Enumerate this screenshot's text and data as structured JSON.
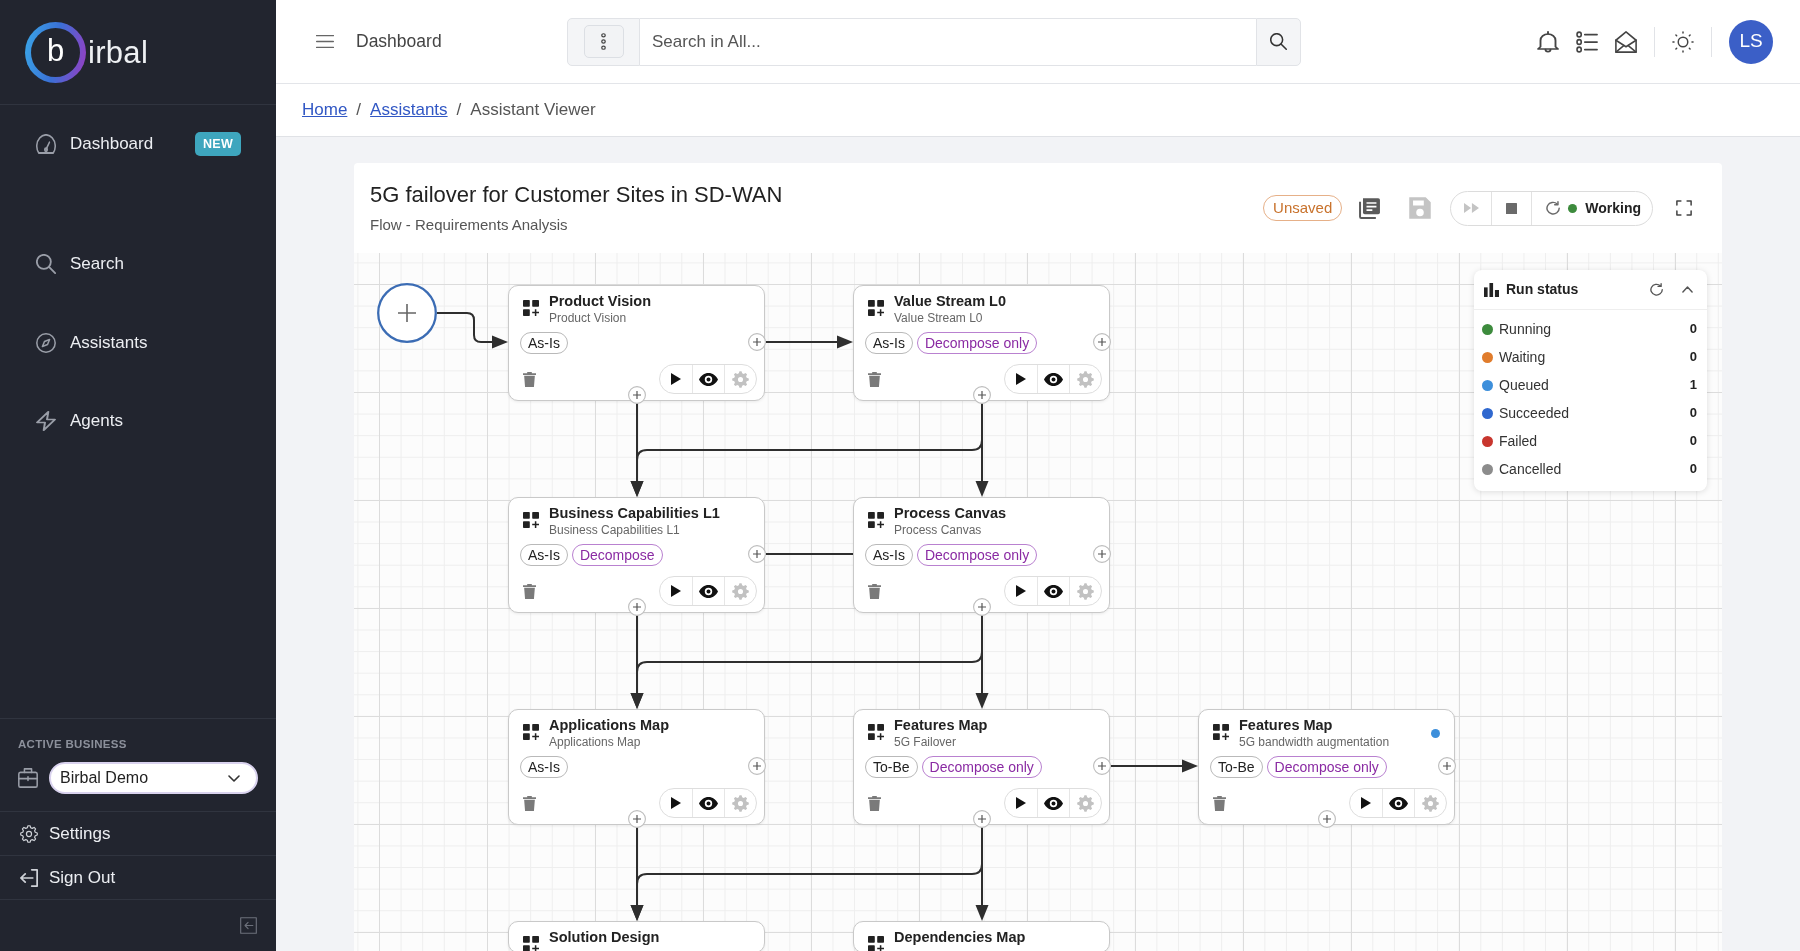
{
  "sidebar": {
    "logo": {
      "mark": "b",
      "text": "irbal"
    },
    "groups": [
      {
        "items": [
          {
            "label": "Dashboard",
            "kind": "dashboard",
            "badge": "NEW",
            "selected": false
          }
        ]
      },
      {
        "items": [
          {
            "label": "Search",
            "kind": "search",
            "selected": false
          },
          {
            "label": "Assistants",
            "kind": "assistants",
            "selected": false
          },
          {
            "label": "Agents",
            "kind": "agents",
            "selected": false
          }
        ]
      }
    ],
    "business": {
      "heading": "ACTIVE BUSINESS",
      "value": "Birbal Demo"
    },
    "footer": [
      {
        "label": "Settings",
        "kind": "settings"
      },
      {
        "label": "Sign Out",
        "kind": "sign-out"
      }
    ]
  },
  "header": {
    "title": "Dashboard",
    "search": {
      "placeholder": "Search in All..."
    },
    "avatar": "LS"
  },
  "breadcrumb": [
    {
      "label": "Home",
      "kind": "link"
    },
    {
      "label": "/",
      "kind": "separator"
    },
    {
      "label": "Assistants",
      "kind": "link"
    },
    {
      "label": "/",
      "kind": "separator"
    },
    {
      "label": "Assistant Viewer",
      "kind": "current"
    }
  ],
  "flow": {
    "title": "5G failover for Customer Sites in SD-WAN",
    "subtitle": "Flow - Requirements Analysis",
    "badge": "Unsaved",
    "tools": [
      {
        "kind": "history",
        "disabled": false
      },
      {
        "kind": "save",
        "disabled": true
      }
    ],
    "run_controls": [
      {
        "kind": "fast-forward",
        "disabled": true
      },
      {
        "kind": "stop",
        "disabled": false
      },
      {
        "kind": "refresh",
        "disabled": false
      }
    ],
    "run_state": "Working"
  },
  "canvas": {
    "start": {
      "links": [
        {
          "kind": "step-right"
        }
      ]
    },
    "rows": [
      {
        "nodes": [
          {
            "title": "Product Vision",
            "subtitle": "Product Vision",
            "tags": [
              {
                "label": "As-Is",
                "kind": "state"
              }
            ],
            "queued": false,
            "links": [
              {
                "kind": "right"
              },
              {
                "kind": "down"
              }
            ]
          },
          {
            "title": "Value Stream L0",
            "subtitle": "Value Stream L0",
            "tags": [
              {
                "label": "As-Is",
                "kind": "state"
              },
              {
                "label": "Decompose only",
                "kind": "mode"
              }
            ],
            "queued": false,
            "links": [
              {
                "kind": "down"
              },
              {
                "kind": "down-left"
              }
            ]
          }
        ]
      },
      {
        "nodes": [
          {
            "title": "Business Capabilities L1",
            "subtitle": "Business Capabilities L1",
            "tags": [
              {
                "label": "As-Is",
                "kind": "state"
              },
              {
                "label": "Decompose",
                "kind": "mode"
              }
            ],
            "queued": false,
            "links": [
              {
                "kind": "right-line"
              },
              {
                "kind": "down"
              }
            ]
          },
          {
            "title": "Process Canvas",
            "subtitle": "Process Canvas",
            "tags": [
              {
                "label": "As-Is",
                "kind": "state"
              },
              {
                "label": "Decompose only",
                "kind": "mode"
              }
            ],
            "queued": false,
            "links": [
              {
                "kind": "down"
              },
              {
                "kind": "down-left"
              }
            ]
          }
        ]
      },
      {
        "nodes": [
          {
            "title": "Applications Map",
            "subtitle": "Applications Map",
            "tags": [
              {
                "label": "As-Is",
                "kind": "state"
              }
            ],
            "queued": false,
            "links": [
              {
                "kind": "down"
              }
            ]
          },
          {
            "title": "Features Map",
            "subtitle": "5G Failover",
            "tags": [
              {
                "label": "To-Be",
                "kind": "state"
              },
              {
                "label": "Decompose only",
                "kind": "mode"
              }
            ],
            "queued": false,
            "links": [
              {
                "kind": "right"
              },
              {
                "kind": "down"
              },
              {
                "kind": "down-left"
              }
            ]
          },
          {
            "title": "Features Map",
            "subtitle": "5G bandwidth augmentation",
            "tags": [
              {
                "label": "To-Be",
                "kind": "state"
              },
              {
                "label": "Decompose only",
                "kind": "mode"
              }
            ],
            "queued": true
          }
        ]
      },
      {
        "nodes": [
          {
            "title": "Solution Design"
          },
          {
            "title": "Dependencies Map"
          }
        ]
      }
    ]
  },
  "run_status": {
    "title": "Run status",
    "expanded": true,
    "items": [
      {
        "label": "Running",
        "count": "0",
        "color": "#3d8b3d"
      },
      {
        "label": "Waiting",
        "count": "0",
        "color": "#e07c2c"
      },
      {
        "label": "Queued",
        "count": "1",
        "color": "#3d8fdb"
      },
      {
        "label": "Succeeded",
        "count": "0",
        "color": "#2f68cf"
      },
      {
        "label": "Failed",
        "count": "0",
        "color": "#c8362e"
      },
      {
        "label": "Cancelled",
        "count": "0",
        "color": "#8c8c8c"
      }
    ]
  }
}
